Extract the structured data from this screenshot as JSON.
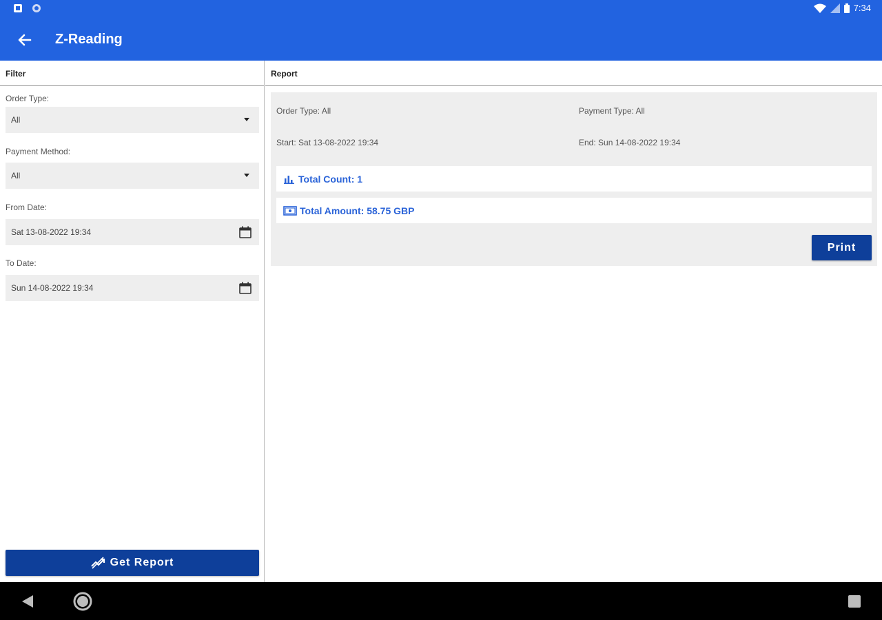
{
  "status_bar": {
    "time": "7:34",
    "left_icons": [
      "notification-icon",
      "sync-icon"
    ],
    "right_icons": [
      "wifi-icon",
      "signal-icon",
      "battery-icon"
    ]
  },
  "app_bar": {
    "title": "Z-Reading",
    "back_icon": "arrow-back-icon"
  },
  "filter": {
    "heading": "Filter",
    "order_type": {
      "label": "Order Type:",
      "value": "All"
    },
    "payment_method": {
      "label": "Payment Method:",
      "value": "All"
    },
    "from_date": {
      "label": "From Date:",
      "value": "Sat 13-08-2022 19:34"
    },
    "to_date": {
      "label": "To Date:",
      "value": "Sun 14-08-2022 19:34"
    },
    "get_report_label": "Get Report"
  },
  "report": {
    "heading": "Report",
    "order_type": "Order Type: All",
    "payment_type": "Payment Type: All",
    "start": "Start: Sat 13-08-2022 19:34",
    "end": "End: Sun 14-08-2022 19:34",
    "total_count": "Total Count: 1",
    "total_amount": "Total Amount: 58.75 GBP",
    "print_label": "Print"
  },
  "colors": {
    "app_bar": "#2263e0",
    "button": "#0e3f9a",
    "accent_text": "#2a63d8",
    "field_bg": "#eeeeee"
  }
}
